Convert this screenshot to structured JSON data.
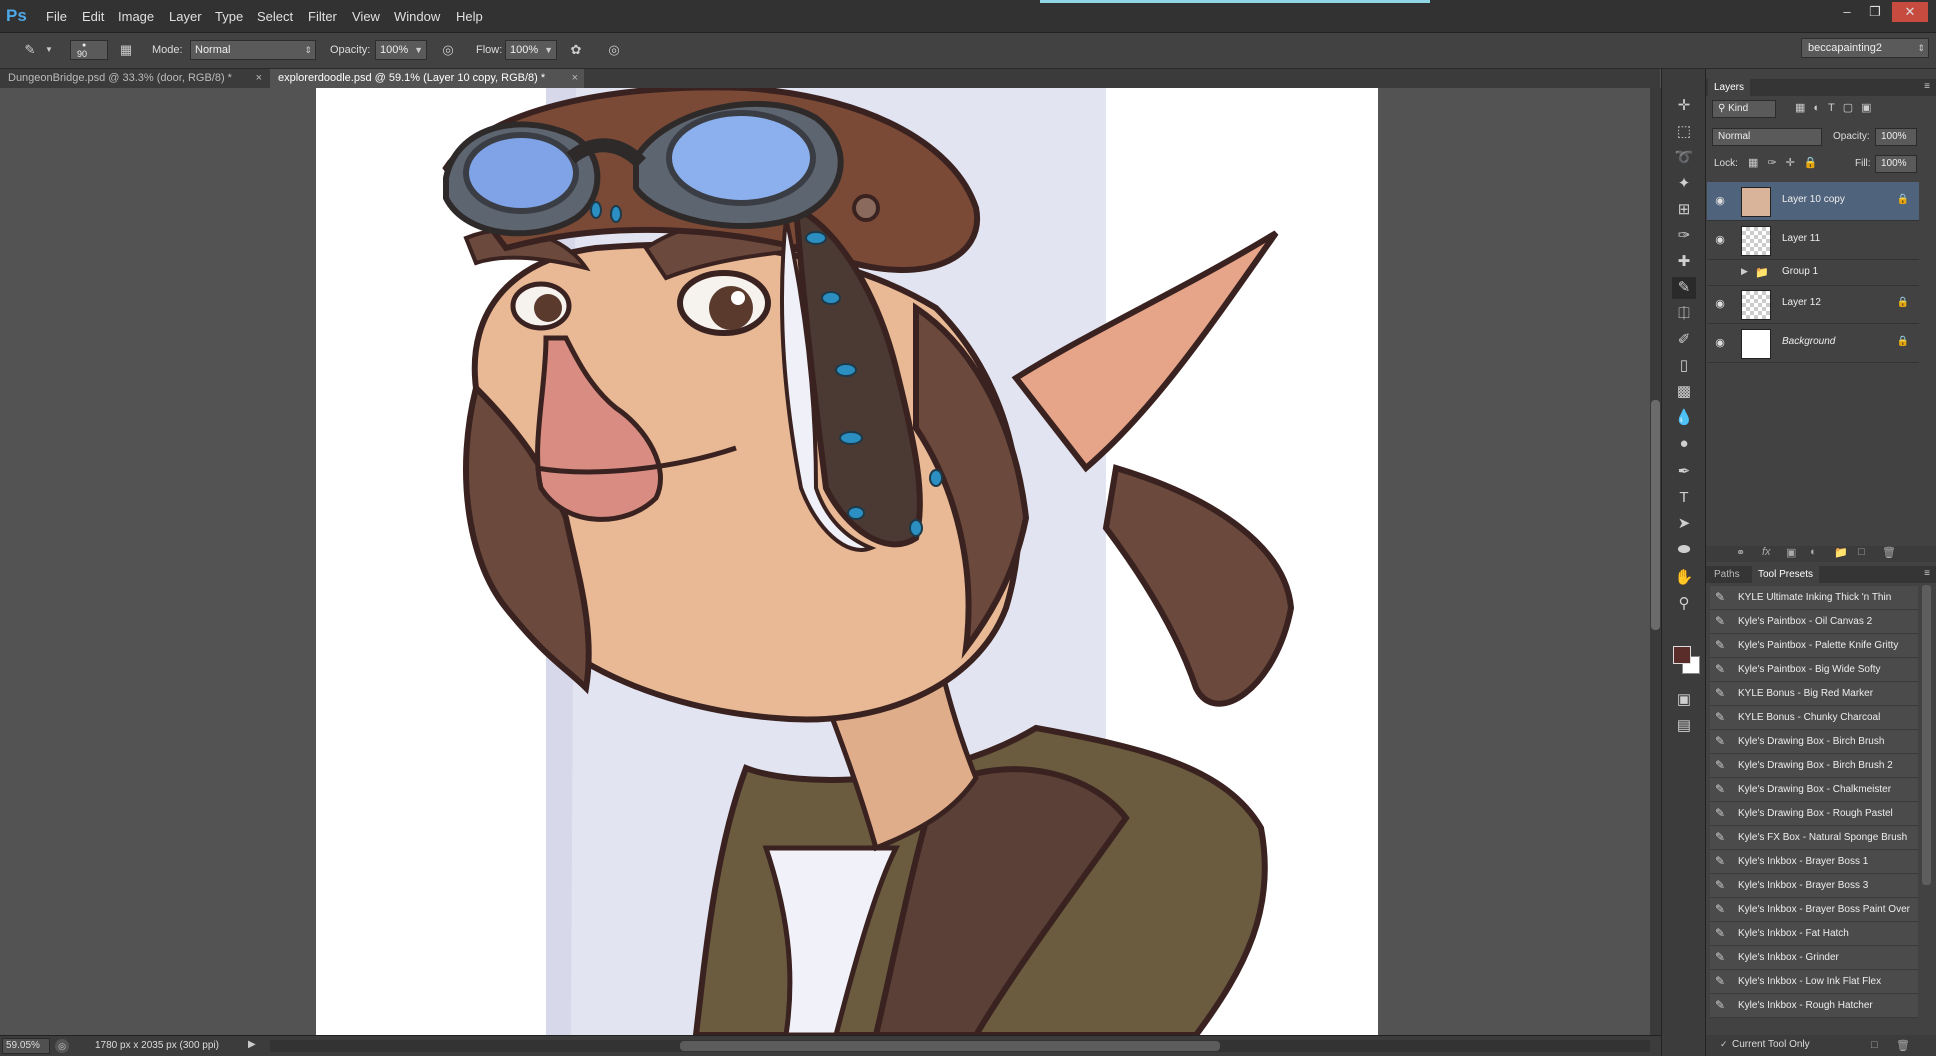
{
  "app": {
    "logo": "Ps",
    "menus": [
      "File",
      "Edit",
      "Image",
      "Layer",
      "Type",
      "Select",
      "Filter",
      "View",
      "Window",
      "Help"
    ],
    "window_controls": [
      "minimize-icon",
      "restore-icon",
      "close-icon"
    ]
  },
  "options": {
    "brush_size": "90",
    "mode_label": "Mode:",
    "mode_value": "Normal",
    "opacity_label": "Opacity:",
    "opacity_value": "100%",
    "flow_label": "Flow:",
    "flow_value": "100%",
    "workspace": "beccapainting2"
  },
  "tabs": [
    {
      "label": "DungeonBridge.psd @ 33.3% (door, RGB/8) *",
      "active": false
    },
    {
      "label": "explorerdoodle.psd @ 59.1% (Layer 10 copy, RGB/8) *",
      "active": true
    }
  ],
  "status": {
    "zoom": "59.05%",
    "doc_info": "1780 px x 2035 px (300 ppi)"
  },
  "colors": {
    "foreground": "#5a2d2a",
    "background": "#ffffff",
    "selected_layer": "#50637c"
  },
  "tools": [
    "move-tool-icon",
    "marquee-tool-icon",
    "lasso-tool-icon",
    "magic-wand-icon",
    "crop-tool-icon",
    "eyedropper-icon",
    "healing-brush-icon",
    "brush-tool-icon",
    "clone-stamp-icon",
    "history-brush-icon",
    "eraser-icon",
    "gradient-tool-icon",
    "blur-tool-icon",
    "dodge-tool-icon",
    "pen-tool-icon",
    "type-tool-icon",
    "path-selection-icon",
    "ellipse-tool-icon",
    "hand-tool-icon",
    "zoom-tool-icon"
  ],
  "layers_panel": {
    "title": "Layers",
    "filter": "Kind",
    "blend_mode": "Normal",
    "opacity_label": "Opacity:",
    "opacity_value": "100%",
    "lock_label": "Lock:",
    "fill_label": "Fill:",
    "fill_value": "100%",
    "layers": [
      {
        "name": "Layer 10 copy",
        "visible": true,
        "locked": true,
        "selected": true
      },
      {
        "name": "Layer 11",
        "visible": true,
        "locked": false,
        "selected": false
      },
      {
        "name": "Group 1",
        "visible": false,
        "locked": false,
        "selected": false
      },
      {
        "name": "Layer 12",
        "visible": true,
        "locked": true,
        "selected": false
      },
      {
        "name": "Background",
        "visible": true,
        "locked": true,
        "selected": false
      }
    ]
  },
  "presets_panel": {
    "tabs": [
      "Paths",
      "Tool Presets"
    ],
    "items": [
      "KYLE Ultimate Inking Thick 'n Thin",
      "Kyle's Paintbox - Oil Canvas 2",
      "Kyle's Paintbox - Palette Knife Gritty",
      "Kyle's Paintbox - Big Wide Softy",
      "KYLE Bonus - Big Red Marker",
      "KYLE Bonus - Chunky Charcoal",
      "Kyle's Drawing Box - Birch Brush",
      "Kyle's Drawing Box - Birch Brush 2",
      "Kyle's Drawing Box - Chalkmeister",
      "Kyle's Drawing Box - Rough Pastel",
      "Kyle's FX Box -  Natural Sponge Brush",
      "Kyle's Inkbox - Brayer Boss 1",
      "Kyle's Inkbox - Brayer Boss 3",
      "Kyle's Inkbox - Brayer Boss Paint Over",
      "Kyle's Inkbox - Fat Hatch",
      "Kyle's Inkbox - Grinder",
      "Kyle's Inkbox - Low Ink Flat Flex",
      "Kyle's Inkbox - Rough Hatcher"
    ],
    "current_tool_only": "Current Tool Only"
  }
}
